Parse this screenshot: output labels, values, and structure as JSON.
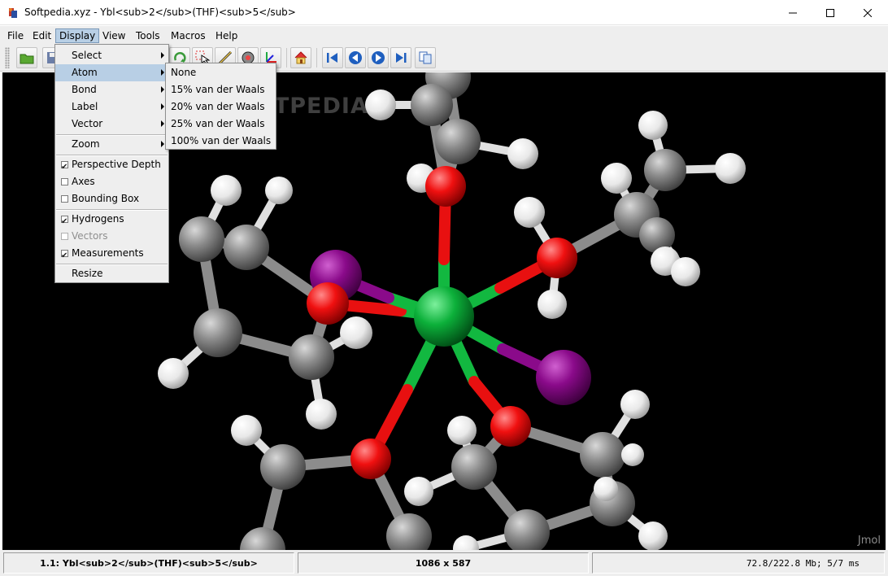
{
  "window": {
    "title": "Softpedia.xyz - Ybl<sub>2</sub>(THF)<sub>5</sub>",
    "controls": [
      "minimize-icon",
      "maximize-icon",
      "close-icon"
    ]
  },
  "menubar": {
    "items": [
      "File",
      "Edit",
      "Display",
      "View",
      "Tools",
      "Macros",
      "Help"
    ],
    "active": "Display"
  },
  "toolbar": {
    "buttons": [
      "open-folder-icon",
      "save-icon",
      "rotate-icon",
      "pick-icon",
      "measure-icon",
      "spin-icon",
      "axes-icon",
      "home-icon",
      "first-frame-icon",
      "prev-frame-icon",
      "next-frame-icon",
      "last-frame-icon",
      "copy-icon"
    ]
  },
  "display_menu": {
    "items": [
      {
        "label": "Select",
        "submenu": true
      },
      {
        "label": "Atom",
        "submenu": true,
        "highlighted": true
      },
      {
        "label": "Bond",
        "submenu": true
      },
      {
        "label": "Label",
        "submenu": true
      },
      {
        "label": "Vector",
        "submenu": true
      },
      {
        "label": "Zoom",
        "submenu": true
      },
      {
        "label": "Perspective Depth",
        "checked": true
      },
      {
        "label": "Axes",
        "checked": false
      },
      {
        "label": "Bounding Box",
        "checked": false
      },
      {
        "label": "Hydrogens",
        "checked": true
      },
      {
        "label": "Vectors",
        "checked": false,
        "disabled": true
      },
      {
        "label": "Measurements",
        "checked": true
      },
      {
        "label": "Resize"
      }
    ]
  },
  "atom_submenu": {
    "items": [
      "None",
      "15% van der Waals",
      "20% van der Waals",
      "25% van der Waals",
      "100% van der Waals"
    ]
  },
  "viewer": {
    "watermark": "SOFTPEDIA",
    "brand": "Jmol",
    "background": "#000000",
    "atom_colors": {
      "carbon": "#8c8c8c",
      "hydrogen": "#ffffff",
      "oxygen": "#ff0d0d",
      "iodine": "#940094",
      "ytterbium": "#00bf38"
    }
  },
  "statusbar": {
    "model": "1.1: Ybl<sub>2</sub>(THF)<sub>5</sub>",
    "size": "1086 x 587",
    "memory": "72.8/222.8 Mb;   5/7 ms"
  }
}
